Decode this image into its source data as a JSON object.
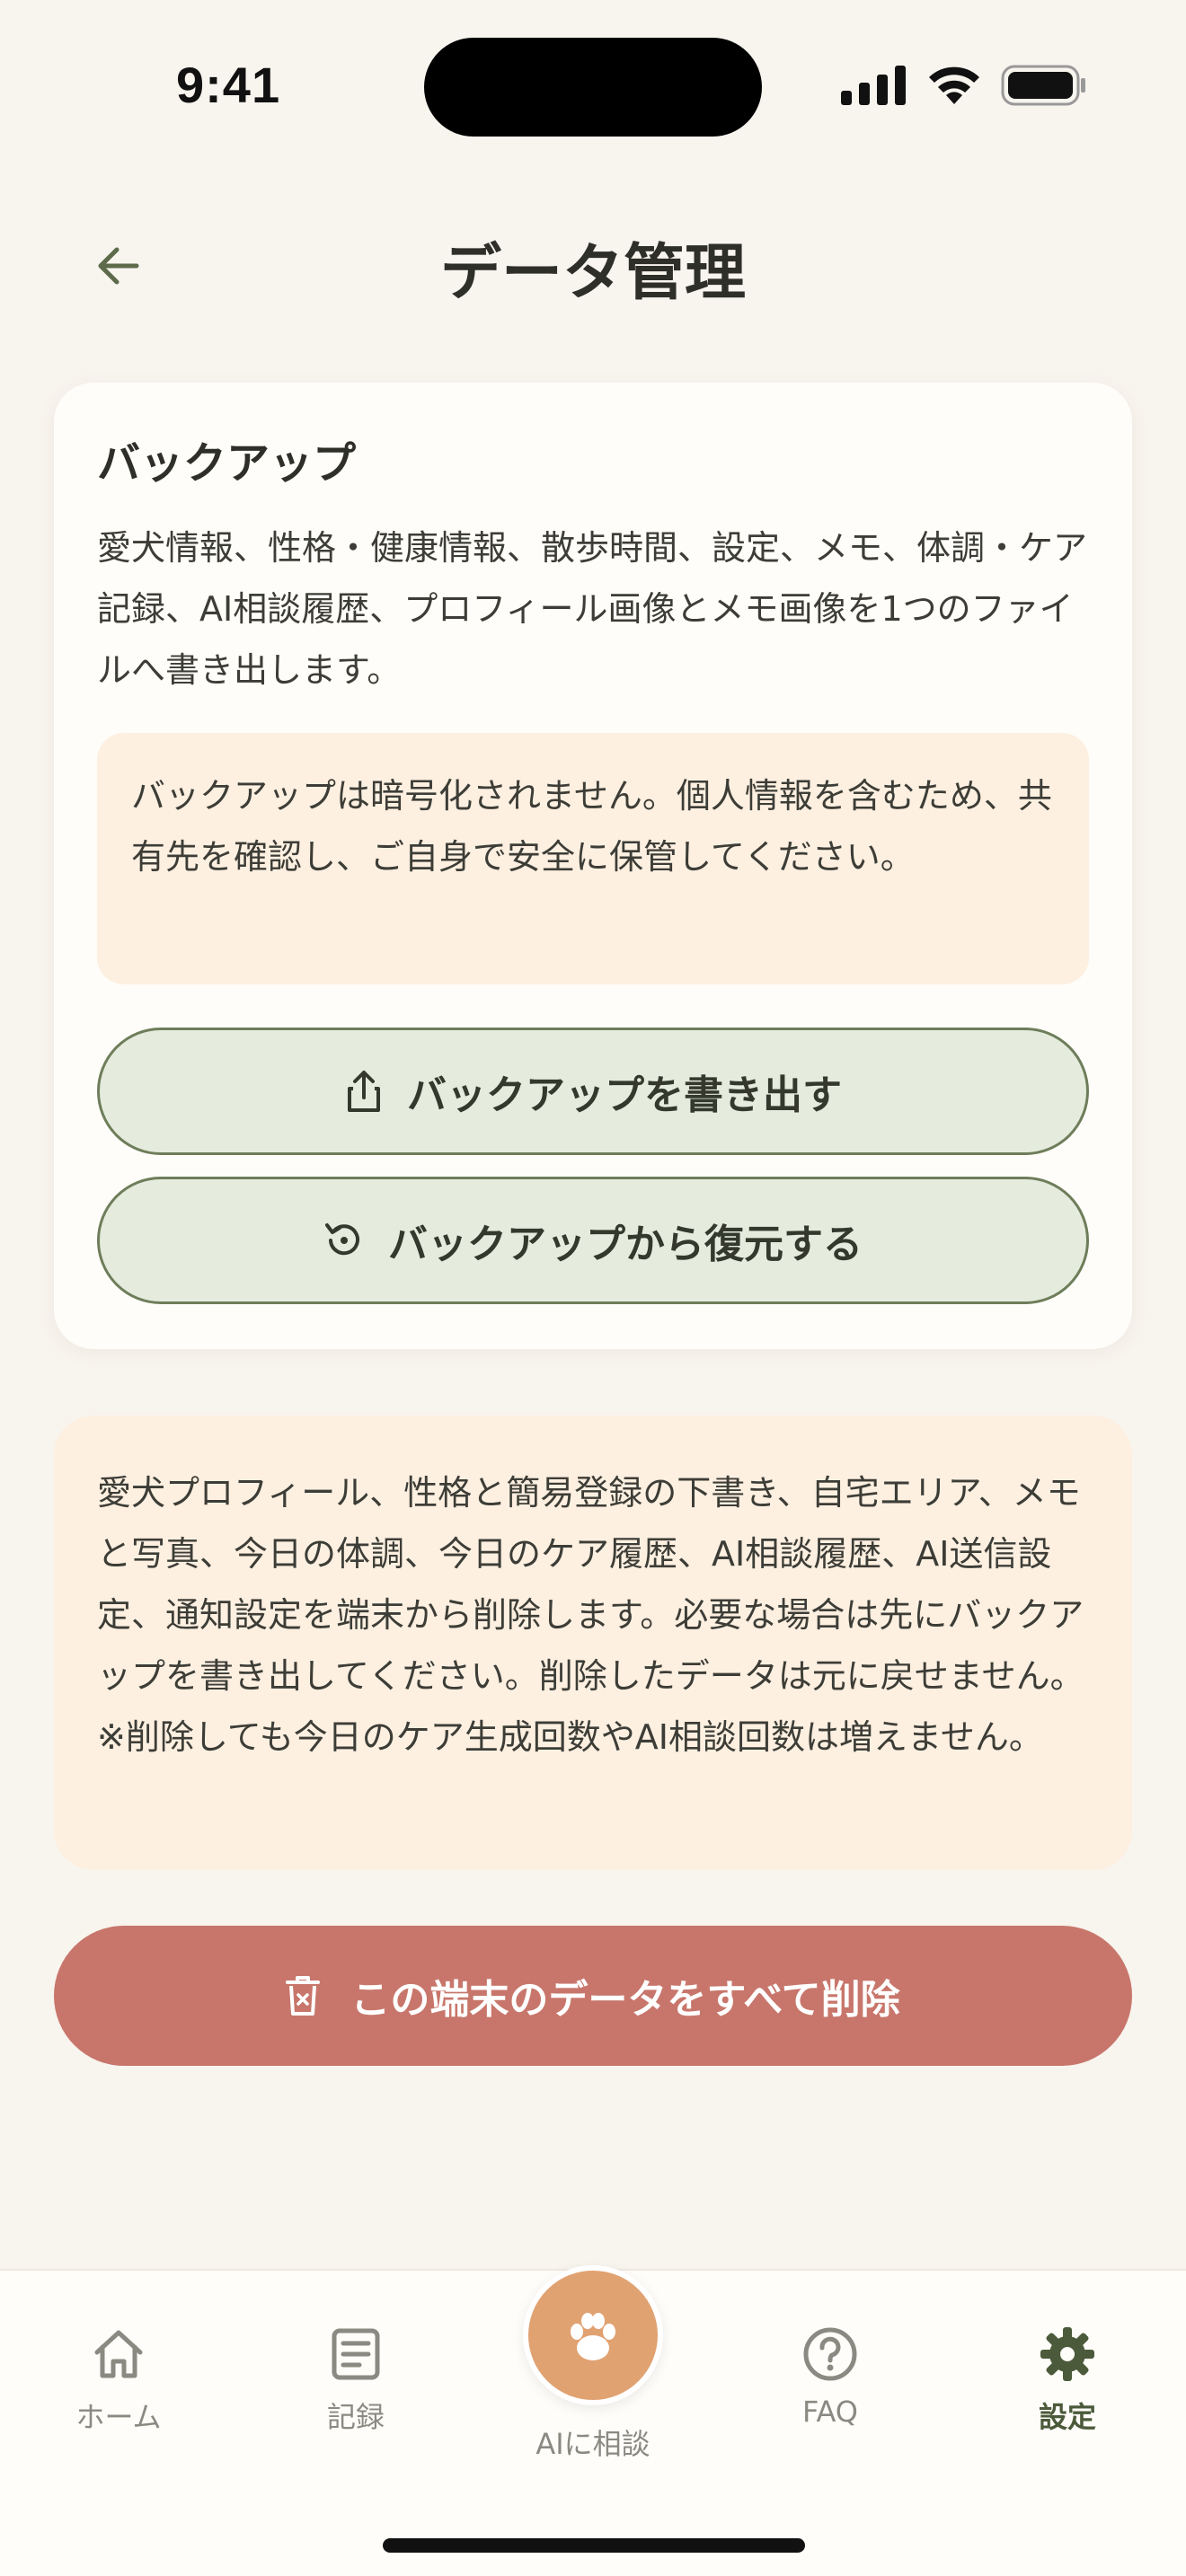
{
  "status_bar": {
    "time": "9:41",
    "icons": [
      "signal-icon",
      "wifi-icon",
      "battery-icon"
    ]
  },
  "header": {
    "title": "データ管理",
    "back_icon": "arrow-left-icon"
  },
  "backup_card": {
    "title": "バックアップ",
    "description": "愛犬情報、性格・健康情報、散歩時間、設定、メモ、体調・ケア記録、AI相談履歴、プロフィール画像とメモ画像を1つのファイルへ書き出します。",
    "warning": "バックアップは暗号化されません。個人情報を含むため、共有先を確認し、ご自身で安全に保管してください。",
    "export_button": "バックアップを書き出す",
    "restore_button": "バックアップから復元する"
  },
  "delete_info": "愛犬プロフィール、性格と簡易登録の下書き、自宅エリア、メモと写真、今日の体調、今日のケア履歴、AI相談履歴、AI送信設定、通知設定を端末から削除します。必要な場合は先にバックアップを書き出してください。削除したデータは元に戻せません。※削除しても今日のケア生成回数やAI相談回数は増えません。",
  "delete_button": "この端末のデータをすべて削除",
  "tab_bar": {
    "home": "ホーム",
    "records": "記録",
    "ai": "AIに相談",
    "faq": "FAQ",
    "settings": "設定",
    "active": "settings"
  },
  "colors": {
    "background": "#f8f4ee",
    "card": "#fffdf9",
    "warning_bg": "#fdf0e1",
    "button_green_bg": "#e5ebdd",
    "button_green_border": "#6e7d5a",
    "danger": "#c8766b",
    "accent_orange": "#e1a272",
    "active_tab": "#4b5a3a"
  }
}
